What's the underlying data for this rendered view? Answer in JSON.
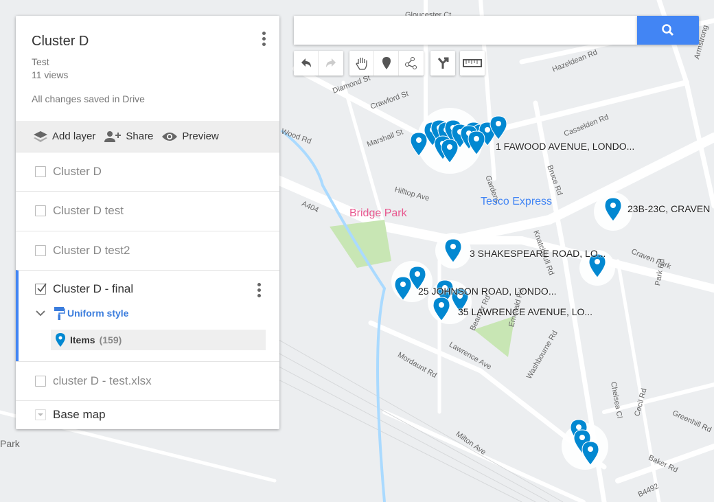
{
  "panel": {
    "title": "Cluster D",
    "description": "Test",
    "views": "11 views",
    "save_status": "All changes saved in Drive",
    "actions": {
      "add_layer": "Add layer",
      "share": "Share",
      "preview": "Preview"
    },
    "layers": [
      {
        "name": "Cluster D",
        "checked": false
      },
      {
        "name": "Cluster D test",
        "checked": false
      },
      {
        "name": "Cluster D test2",
        "checked": false
      },
      {
        "name": "Cluster D - final",
        "checked": true,
        "style": "Uniform style",
        "items_label": "Items",
        "items_count": "(159)"
      },
      {
        "name": "cluster D - test.xlsx",
        "checked": false
      }
    ],
    "base_map": "Base map"
  },
  "search": {
    "value": "",
    "placeholder": "",
    "button_icon": "search-icon"
  },
  "toolbar": [
    "undo-icon",
    "redo-icon",
    "hand-icon",
    "marker-icon",
    "draw-line-icon",
    "directions-icon",
    "ruler-icon"
  ],
  "map": {
    "streets": [
      "Gloucester Ct",
      "Hazeldean Rd",
      "Casselden Rd",
      "Bruce Rd",
      "Crawford St",
      "Marshall St",
      "Diamond St",
      "Wood Rd",
      "Hilltop Ave",
      "A404",
      "Craven Park",
      "Knatchbull Rd",
      "Park Rd",
      "Mordaunt Rd",
      "Lawrence Ave",
      "Washbourne Rd",
      "Milton Ave",
      "Chelsea Cl",
      "Cecil Rd",
      "Greenhill Rd",
      "Baker Rd",
      "B4492",
      "Gardens",
      "Armstrong",
      "Emerald Rd",
      "Beamer Rd"
    ],
    "pois": {
      "bridge_park": "Bridge Park",
      "tesco": "Tesco Express",
      "park_left": "Park"
    },
    "addresses": [
      "1 FAWOOD AVENUE, LONDO...",
      "23B-23C, CRAVEN",
      "3 SHAKESPEARE ROAD, LO...",
      "25 JOHNSON ROAD, LONDO...",
      "35 LAWRENCE AVENUE, LO..."
    ],
    "colors": {
      "marker": "#0288d1",
      "tesco": "#4285f4",
      "bridge_park": "#e8588f",
      "park_green": "#c8e6b4",
      "water": "#aadaff"
    }
  },
  "colors": {
    "accent": "#4285f4",
    "style_link": "#3b7ddd"
  }
}
